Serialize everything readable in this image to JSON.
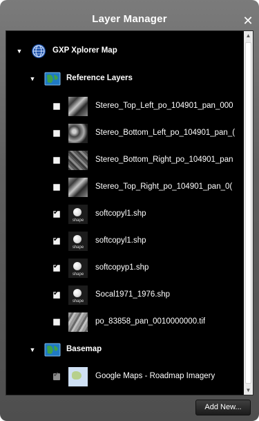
{
  "window": {
    "title": "Layer Manager"
  },
  "tree": {
    "root": {
      "label": "GXP Xplorer Map",
      "icon": "globe-network-icon"
    },
    "groups": [
      {
        "label": "Reference Layers",
        "icon": "map-folder-icon",
        "layers": [
          {
            "label": "Stereo_Top_Left_po_104901_pan_000",
            "checked": false,
            "thumb": "satellite-thumbnail"
          },
          {
            "label": "Stereo_Bottom_Left_po_104901_pan_(",
            "checked": false,
            "thumb": "satellite-thumbnail"
          },
          {
            "label": "Stereo_Bottom_Right_po_104901_pan",
            "checked": false,
            "thumb": "satellite-thumbnail"
          },
          {
            "label": "Stereo_Top_Right_po_104901_pan_0(",
            "checked": false,
            "thumb": "satellite-thumbnail"
          },
          {
            "label": "softcopyl1.shp",
            "checked": true,
            "thumb": "shapefile-icon"
          },
          {
            "label": "softcopyl1.shp",
            "checked": true,
            "thumb": "shapefile-icon"
          },
          {
            "label": "softcopyp1.shp",
            "checked": true,
            "thumb": "shapefile-icon"
          },
          {
            "label": "Socal1971_1976.shp",
            "checked": true,
            "thumb": "shapefile-icon"
          },
          {
            "label": "po_83858_pan_0010000000.tif",
            "checked": false,
            "thumb": "raster-thumbnail"
          }
        ]
      },
      {
        "label": "Basemap",
        "icon": "map-folder-icon",
        "layers": [
          {
            "label": "Google Maps - Roadmap Imagery",
            "checked": true,
            "disabled": true,
            "thumb": "google-map-thumbnail"
          }
        ]
      }
    ]
  },
  "shapefile_caption": "shape",
  "footer": {
    "add_new_label": "Add New..."
  }
}
